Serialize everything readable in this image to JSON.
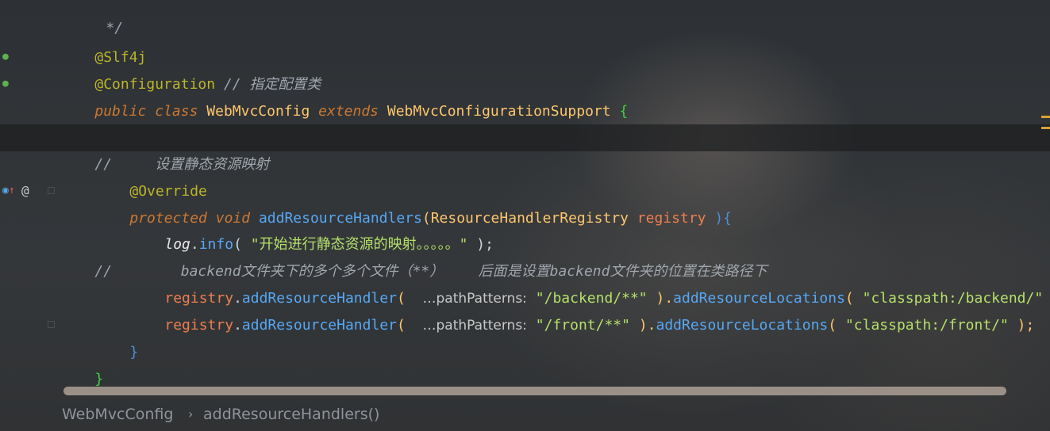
{
  "editor": {
    "lines": {
      "l0": "*/",
      "l1_ann": "@Slf4j",
      "l2_ann": "@Configuration",
      "l2_cmt": "// 指定配置类",
      "l3_kw1": "public",
      "l3_kw2": "class",
      "l3_cls": "WebMvcConfig",
      "l3_kw3": "extends",
      "l3_sup": "WebMvcConfigurationSupport",
      "l3_brace": "{",
      "l5_cmt": "//     设置静态资源映射",
      "l6_ann": "@Override",
      "l7_kw1": "protected",
      "l7_kw2": "void",
      "l7_fn": "addResourceHandlers",
      "l7_open": "(",
      "l7_type": "ResourceHandlerRegistry",
      "l7_param": "registry",
      "l7_close": " ){",
      "l8_log": "log",
      "l8_dot": ".",
      "l8_fn": "info",
      "l8_open": "( ",
      "l8_str": "\"开始进行静态资源的映射。。。。。\"",
      "l8_close": " );",
      "l9_cmt": "//        backend文件夹下的多个多个文件（**）    后面是设置backend文件夹的位置在类路径下",
      "l10_obj": "registry",
      "l10_dot": ".",
      "l10_fn": "addResourceHandler",
      "l10_open": "( ",
      "l10_hint": "…pathPatterns:",
      "l10_str1": "\"/backend/**\"",
      "l10_mid": " ).",
      "l10_fn2": "addResourceLocations",
      "l10_open2": "( ",
      "l10_str2": "\"classpath:/backend/\"",
      "l10_close": " );",
      "l11_obj": "registry",
      "l11_dot": ".",
      "l11_fn": "addResourceHandler",
      "l11_open": "( ",
      "l11_hint": "…pathPatterns:",
      "l11_str1": "\"/front/**\"",
      "l11_mid": " ).",
      "l11_fn2": "addResourceLocations",
      "l11_open2": "( ",
      "l11_str2": "\"classpath:/front/\"",
      "l11_close": " );",
      "l12_brace": "}",
      "l13_brace": "}"
    }
  },
  "gutter": {
    "bean_icon_1": "spring-bean-icon",
    "bean_icon_2": "spring-bean-icon",
    "override_icon": "override-method-icon",
    "at_symbol": "@"
  },
  "breadcrumb": {
    "class_name": "WebMvcConfig",
    "separator": "›",
    "method_name": "addResourceHandlers()"
  },
  "colors": {
    "keyword": "#cc7832",
    "annotation": "#bbb529",
    "class": "#ffc66d",
    "method": "#56a8f5",
    "string": "#b5e06a",
    "comment": "#a0a6ad"
  }
}
